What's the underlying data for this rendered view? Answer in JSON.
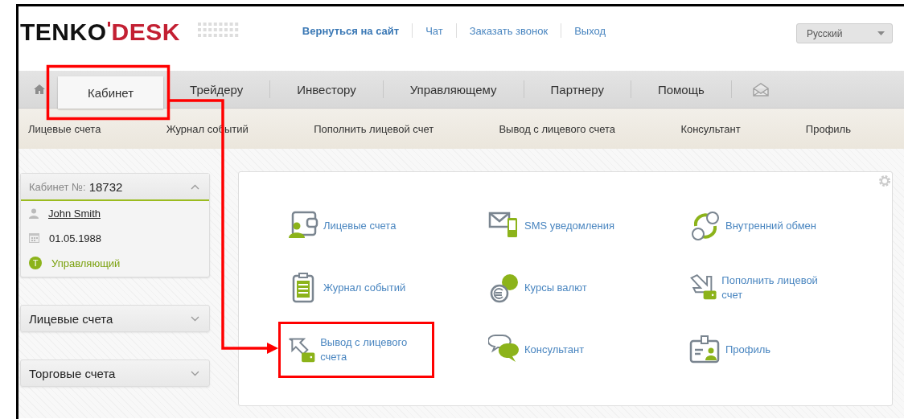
{
  "logo": {
    "part1": "TENKO",
    "part2": "DESK"
  },
  "top_links": [
    {
      "label": "Вернуться на сайт",
      "bold": true
    },
    {
      "label": "Чат",
      "bold": false
    },
    {
      "label": "Заказать звонок",
      "bold": false
    },
    {
      "label": "Выход",
      "bold": false
    }
  ],
  "language_select": {
    "value": "Русский"
  },
  "nav_tabs": [
    {
      "label": "Кабинет",
      "selected": true
    },
    {
      "label": "Трейдеру",
      "selected": false
    },
    {
      "label": "Инвестору",
      "selected": false
    },
    {
      "label": "Управляющему",
      "selected": false
    },
    {
      "label": "Партнеру",
      "selected": false
    },
    {
      "label": "Помощь",
      "selected": false
    }
  ],
  "sub_nav": [
    "Лицевые счета",
    "Журнал событий",
    "Пополнить лицевой счет",
    "Вывод с лицевого счета",
    "Консультант",
    "Профиль"
  ],
  "sidebar": {
    "cabinet_card": {
      "label": "Кабинет №:",
      "number": "18732",
      "expanded": true,
      "name": "John Smith",
      "birth_date": "01.05.1988",
      "role_badge": "T",
      "role": "Управляющий"
    },
    "panels": [
      {
        "title": "Лицевые счета",
        "expanded": false
      },
      {
        "title": "Торговые счета",
        "expanded": false
      }
    ]
  },
  "dashboard_items": [
    {
      "label": "Лицевые счета",
      "highlighted": false
    },
    {
      "label": "SMS уведомления",
      "highlighted": false
    },
    {
      "label": "Внутренний обмен",
      "highlighted": false
    },
    {
      "label": "Журнал событий",
      "highlighted": false
    },
    {
      "label": "Курсы валют",
      "highlighted": false
    },
    {
      "label": "Пополнить лицевой счет",
      "highlighted": false
    },
    {
      "label": "Вывод с лицевого счета",
      "highlighted": true
    },
    {
      "label": "Консультант",
      "highlighted": false
    },
    {
      "label": "Профиль",
      "highlighted": false
    }
  ]
}
